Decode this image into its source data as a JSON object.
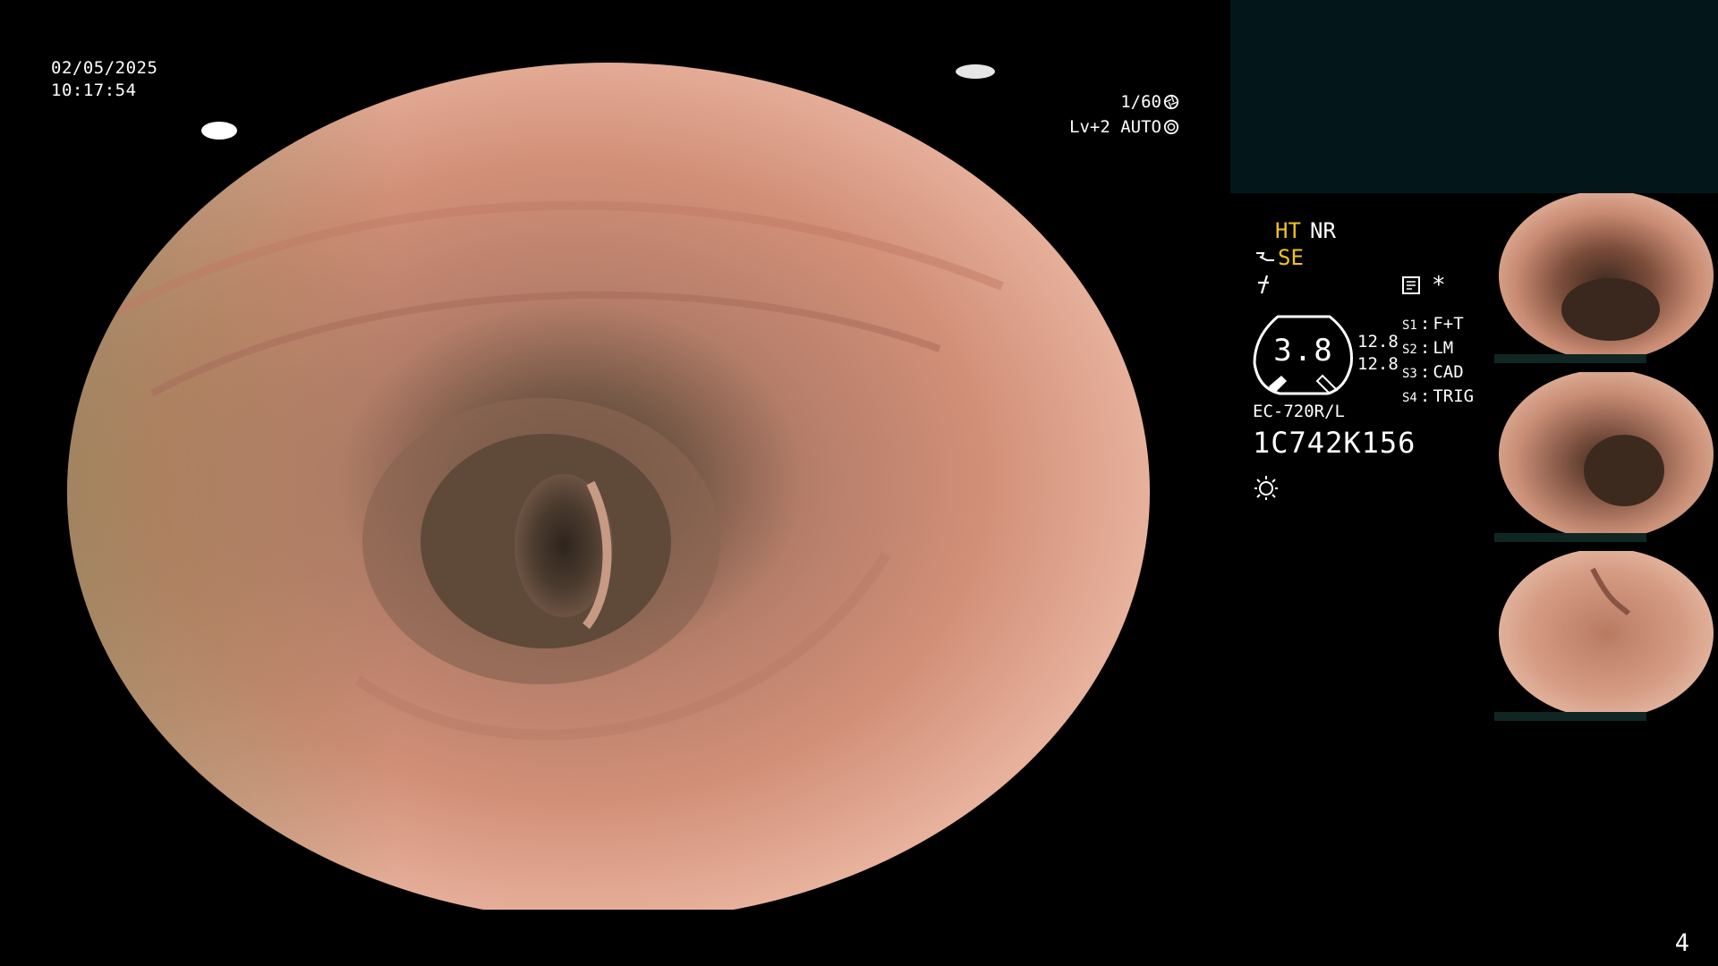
{
  "overlay": {
    "date": "02/05/2025",
    "time": "10:17:54",
    "shutter": "1/60",
    "brightness": "Lv+2 AUTO"
  },
  "modes": {
    "ht": "HT",
    "nr": "NR",
    "se": "SE",
    "asterisk": "*"
  },
  "gauge": {
    "value": "3.8",
    "sub_top": "12.8",
    "sub_bottom": "12.8"
  },
  "soft_keys": [
    {
      "key": "S1",
      "label": "F+T"
    },
    {
      "key": "S2",
      "label": "LM"
    },
    {
      "key": "S3",
      "label": "CAD"
    },
    {
      "key": "S4",
      "label": "TRIG"
    }
  ],
  "scope": {
    "model": "EC-720R/L",
    "serial": "1C742K156"
  },
  "page_number": "4",
  "colors": {
    "highlight": "#f0c419",
    "panel": "#03171a",
    "tissue": "#d88f7a"
  },
  "icons": [
    "shutter-icon",
    "iris-icon",
    "scope-se-icon",
    "freeze-icon",
    "memo-icon",
    "light-icon"
  ]
}
